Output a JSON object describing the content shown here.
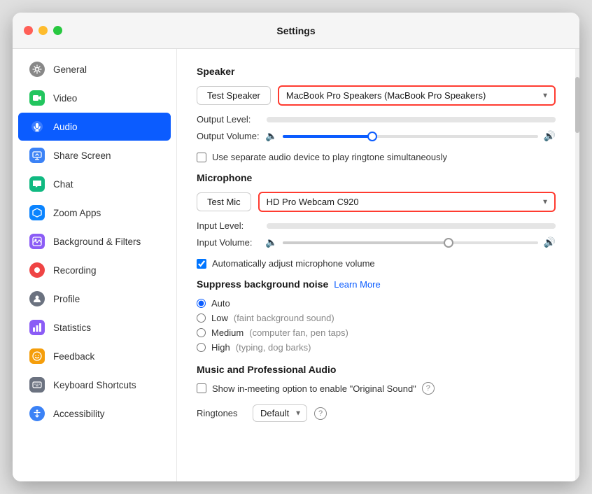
{
  "window": {
    "title": "Settings"
  },
  "sidebar": {
    "items": [
      {
        "id": "general",
        "label": "General",
        "icon": "⚙",
        "iconClass": "icon-general"
      },
      {
        "id": "video",
        "label": "Video",
        "icon": "▶",
        "iconClass": "icon-video"
      },
      {
        "id": "audio",
        "label": "Audio",
        "icon": "🎧",
        "iconClass": "icon-audio",
        "active": true
      },
      {
        "id": "sharescreen",
        "label": "Share Screen",
        "icon": "⬛",
        "iconClass": "icon-sharescreen"
      },
      {
        "id": "chat",
        "label": "Chat",
        "icon": "💬",
        "iconClass": "icon-chat"
      },
      {
        "id": "zoomapps",
        "label": "Zoom Apps",
        "icon": "⬡",
        "iconClass": "icon-zoomapps"
      },
      {
        "id": "bgfilters",
        "label": "Background & Filters",
        "icon": "🖼",
        "iconClass": "icon-bgfilters"
      },
      {
        "id": "recording",
        "label": "Recording",
        "icon": "⏺",
        "iconClass": "icon-recording"
      },
      {
        "id": "profile",
        "label": "Profile",
        "icon": "👤",
        "iconClass": "icon-profile"
      },
      {
        "id": "statistics",
        "label": "Statistics",
        "icon": "📊",
        "iconClass": "icon-statistics"
      },
      {
        "id": "feedback",
        "label": "Feedback",
        "icon": "😊",
        "iconClass": "icon-feedback"
      },
      {
        "id": "keyboard",
        "label": "Keyboard Shortcuts",
        "icon": "⌨",
        "iconClass": "icon-keyboard"
      },
      {
        "id": "accessibility",
        "label": "Accessibility",
        "icon": "♿",
        "iconClass": "icon-accessibility"
      }
    ]
  },
  "audio": {
    "speaker_section_title": "Speaker",
    "test_speaker_btn": "Test Speaker",
    "speaker_device": "MacBook Pro Speakers (MacBook Pro Speakers)",
    "output_level_label": "Output Level:",
    "output_volume_label": "Output Volume:",
    "output_volume_pct": 35,
    "separate_device_label": "Use separate audio device to play ringtone simultaneously",
    "microphone_section_title": "Microphone",
    "test_mic_btn": "Test Mic",
    "mic_device": "HD Pro Webcam C920",
    "input_level_label": "Input Level:",
    "input_volume_label": "Input Volume:",
    "input_volume_pct": 65,
    "auto_adjust_label": "Automatically adjust microphone volume",
    "suppress_label": "Suppress background noise",
    "learn_more": "Learn More",
    "radio_auto": "Auto",
    "radio_low": "Low",
    "radio_low_hint": "(faint background sound)",
    "radio_medium": "Medium",
    "radio_medium_hint": "(computer fan, pen taps)",
    "radio_high": "High",
    "radio_high_hint": "(typing, dog barks)",
    "music_audio_title": "Music and Professional Audio",
    "original_sound_label": "Show in-meeting option to enable \"Original Sound\"",
    "ringtones_label": "Ringtones",
    "ringtones_value": "Default"
  }
}
